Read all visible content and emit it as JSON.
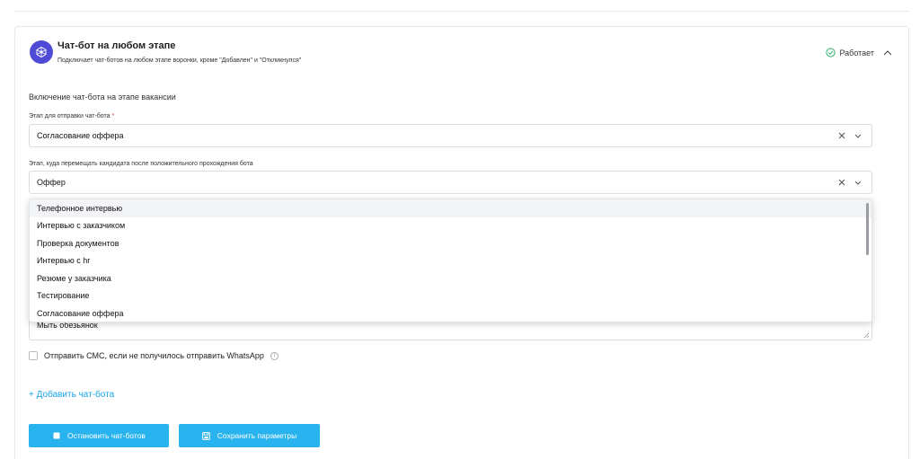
{
  "header": {
    "title": "Чат-бот на любом этапе",
    "description": "Подключает чат-ботов на любом этапе воронки, кроме \"Добавлен\" и \"Откликнулся\"",
    "status": "Работает"
  },
  "section": {
    "title": "Включение чат-бота на этапе вакансии"
  },
  "send_stage": {
    "label": "Этап для отправки чат-бота",
    "required_mark": "*",
    "value": "Согласование оффера"
  },
  "move_stage": {
    "label": "Этап, куда перемещать кандидата после положительного прохождения бота",
    "value": "Оффер"
  },
  "dropdown": {
    "options": [
      "Телефонное интервью",
      "Интервью с заказчиком",
      "Проверка документов",
      "Интервью с hr",
      "Резюме у заказчика",
      "Тестирование",
      "Согласование оффера"
    ],
    "highlighted_index": 0
  },
  "textarea": {
    "value": "Мыть обезьянок"
  },
  "sms": {
    "label": "Отправить СМС, если не получилось отправить WhatsApp",
    "checked": false
  },
  "add_bot": {
    "label": "+ Добавить чат-бота"
  },
  "buttons": {
    "stop_label": "Остановить чат-ботов",
    "save_label": "Сохранить параметры"
  },
  "colors": {
    "accent": "#29b3ee",
    "link": "#17a3e8",
    "status_ok": "#33b36b",
    "avatar": "#4f4bd6",
    "required": "#e2362f"
  },
  "icons": {
    "avatar": "bot-network-icon",
    "status": "check-circle-icon",
    "collapse": "chevron-up-icon",
    "clear": "close-icon",
    "chevron": "chevron-down-icon",
    "info": "info-icon",
    "stop": "stop-square-icon",
    "save": "save-icon"
  }
}
